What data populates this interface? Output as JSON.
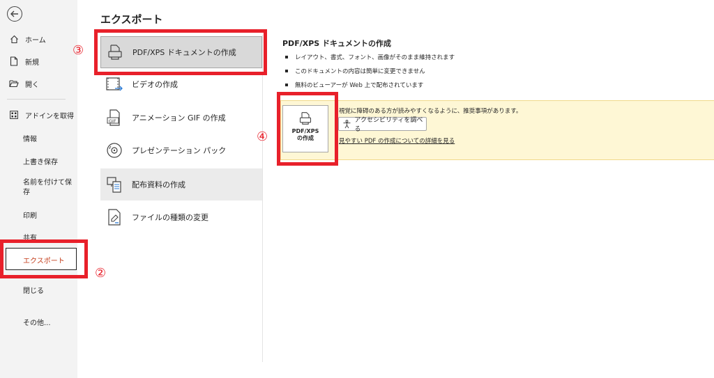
{
  "sidebar": {
    "items": [
      {
        "label": "ホーム",
        "icon": "home-icon"
      },
      {
        "label": "新規",
        "icon": "new-document-icon"
      },
      {
        "label": "開く",
        "icon": "folder-open-icon"
      },
      {
        "label": "アドインを取得",
        "icon": "addins-grid-icon"
      },
      {
        "label": "情報"
      },
      {
        "label": "上書き保存"
      },
      {
        "label": "名前を付けて保存"
      },
      {
        "label": "印刷"
      },
      {
        "label": "共有"
      },
      {
        "label": "エクスポート"
      },
      {
        "label": "閉じる"
      },
      {
        "label": "その他..."
      }
    ]
  },
  "page": {
    "title": "エクスポート"
  },
  "export_options": [
    {
      "label": "PDF/XPS ドキュメントの作成",
      "icon": "pdf-document-icon"
    },
    {
      "label": "ビデオの作成",
      "icon": "video-icon"
    },
    {
      "label": "アニメーション GIF の作成",
      "icon": "gif-icon"
    },
    {
      "label": "プレゼンテーション パック",
      "icon": "disc-icon"
    },
    {
      "label": "配布資料の作成",
      "icon": "handout-icon"
    },
    {
      "label": "ファイルの種類の変更",
      "icon": "file-type-icon"
    }
  ],
  "detail": {
    "title": "PDF/XPS ドキュメントの作成",
    "bullets": [
      "レイアウト、書式、フォント、画像がそのまま維持されます",
      "このドキュメントの内容は簡単に変更できません",
      "無料のビューアーが Web 上で配布されています"
    ],
    "button_line1": "PDF/XPS",
    "button_line2": "の作成",
    "notice_text": "視覚に障碍のある方が読みやすくなるように、推奨事項があります。",
    "accessibility_button": "アクセシビリティを調べる",
    "notice_link": "見やすい PDF の作成についての詳細を見る"
  },
  "annotations": {
    "step2": "②",
    "step3": "③",
    "step4": "④",
    "color": "#e8202a"
  }
}
